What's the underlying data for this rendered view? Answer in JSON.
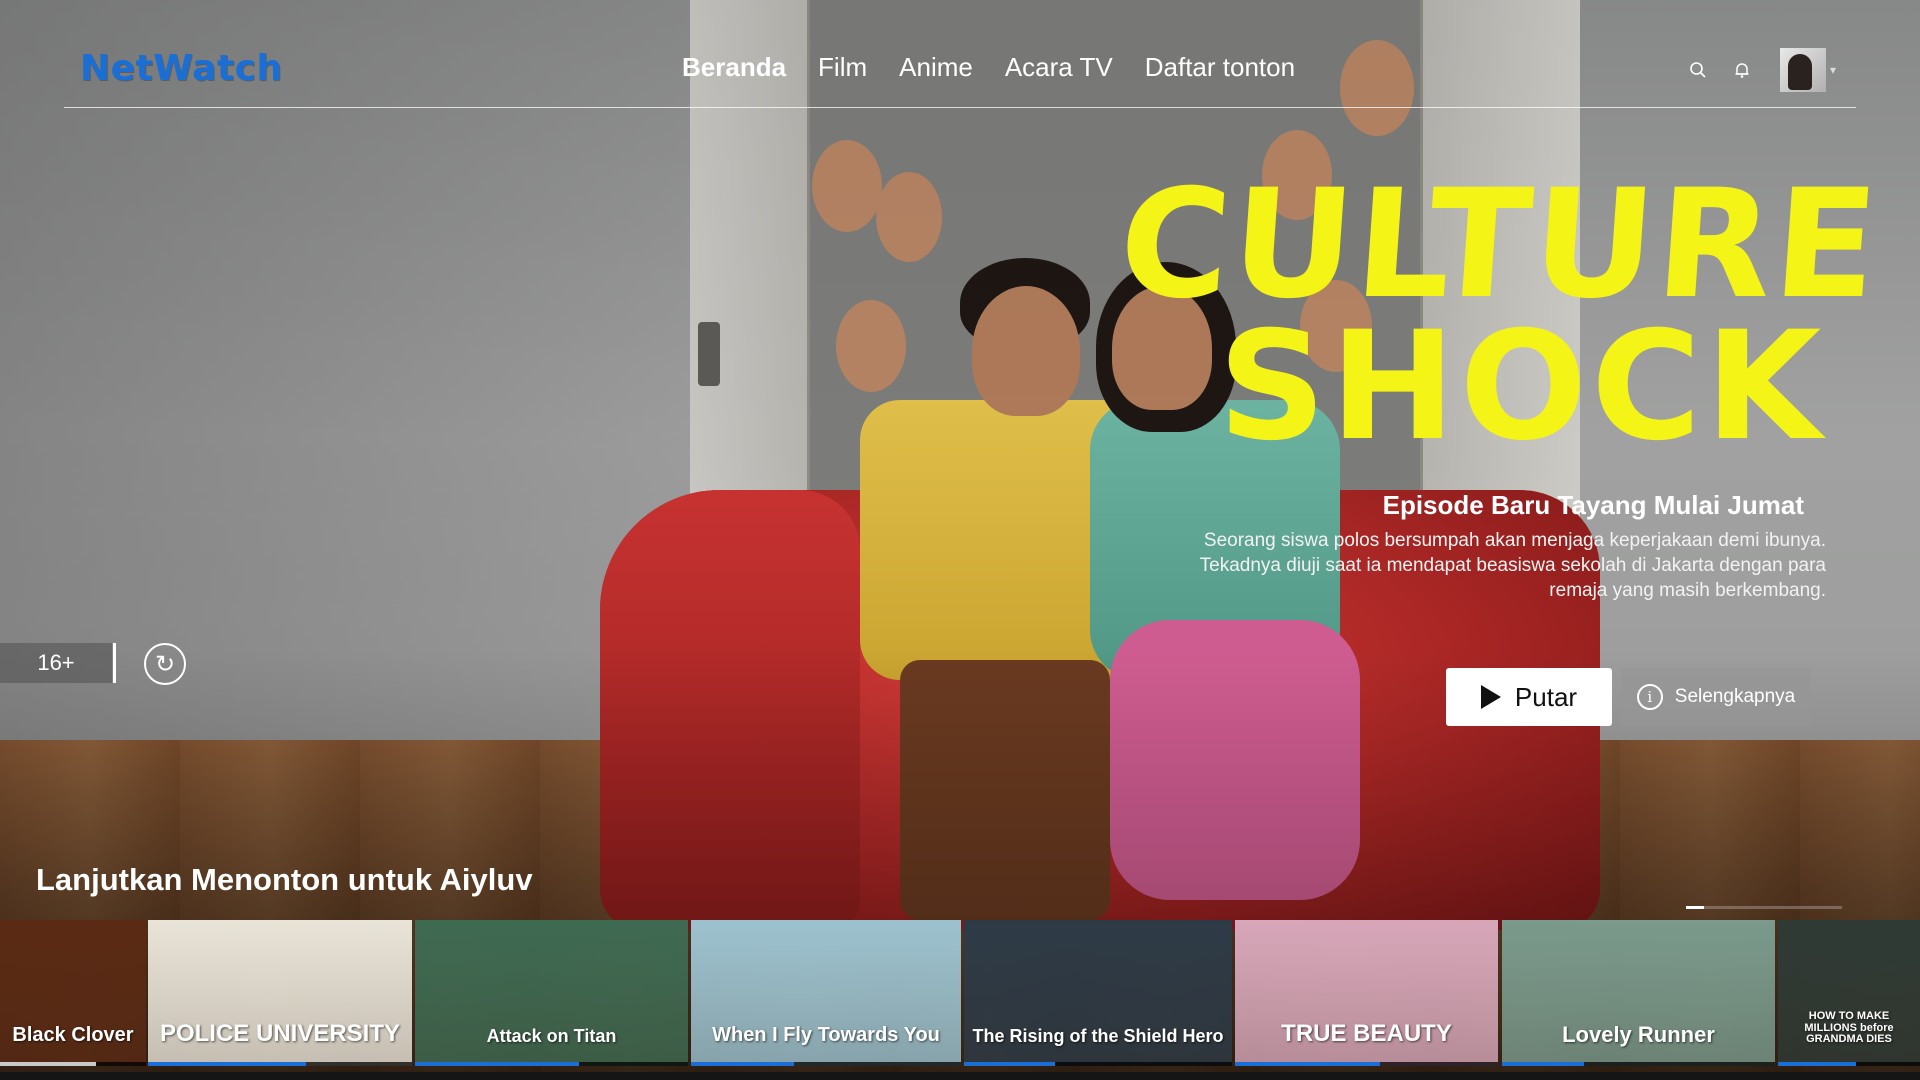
{
  "brand": {
    "logo_text": "NetWatch",
    "accent": "#1a6fd6"
  },
  "nav": [
    {
      "label": "Beranda",
      "active": true
    },
    {
      "label": "Film",
      "active": false
    },
    {
      "label": "Anime",
      "active": false
    },
    {
      "label": "Acara TV",
      "active": false
    },
    {
      "label": "Daftar tonton",
      "active": false
    }
  ],
  "header_icons": [
    "search-icon",
    "bell-icon",
    "avatar",
    "caret-down-icon"
  ],
  "hero": {
    "title_line1": "CULTURE",
    "title_line2": "SHOCK",
    "title_color": "#f4f417",
    "episode_label": "Episode Baru Tayang Mulai Jumat",
    "synopsis": "Seorang siswa polos bersumpah akan menjaga keperjakaan demi ibunya. Tekadnya diuji saat ia mendapat beasiswa sekolah di Jakarta dengan para remaja yang masih berkembang.",
    "play_label": "Putar",
    "more_label": "Selengkapnya",
    "rating": "16+",
    "replay_icon": "replay-icon"
  },
  "row": {
    "title": "Lanjutkan Menonton untuk Aiyluv",
    "pager": {
      "pages": 8,
      "current": 1
    },
    "items": [
      {
        "title": "Black Clover",
        "bg": "#5a2a14",
        "progress": 0.66,
        "bar": "#c9c9c9"
      },
      {
        "title": "POLICE UNIVERSITY",
        "bg": "#e9e4d8",
        "progress": 0.6,
        "bar": "#1a6fd6"
      },
      {
        "title": "Attack on Titan",
        "bg": "#3f6a52",
        "progress": 0.6,
        "bar": "#1a6fd6"
      },
      {
        "title": "When I Fly Towards You",
        "bg": "#9cc2cf",
        "progress": 0.38,
        "bar": "#1a6fd6"
      },
      {
        "title": "The Rising of the Shield Hero",
        "bg": "#2d3a46",
        "progress": 0.34,
        "bar": "#1a6fd6"
      },
      {
        "title": "TRUE BEAUTY",
        "bg": "#d7a7b9",
        "progress": 0.55,
        "bar": "#1a6fd6"
      },
      {
        "title": "Lovely Runner",
        "bg": "#7a9a8c",
        "progress": 0.3,
        "bar": "#1a6fd6"
      },
      {
        "title": "HOW TO MAKE MILLIONS before GRANDMA DIES",
        "bg": "#2f3a35",
        "progress": 0.55,
        "bar": "#1a6fd6"
      }
    ]
  }
}
